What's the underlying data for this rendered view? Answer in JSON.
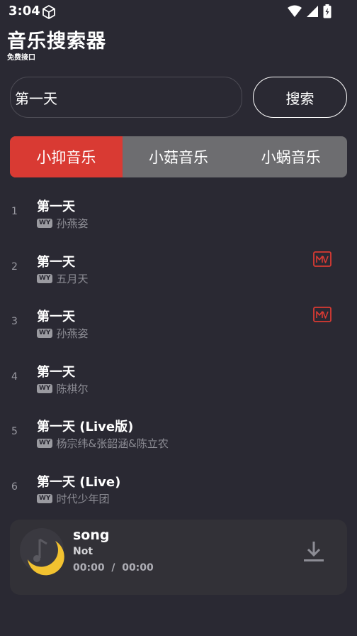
{
  "status": {
    "time": "3:04"
  },
  "app": {
    "title": "音乐搜索器",
    "subtitle": "免费接口"
  },
  "search": {
    "value": "第一天",
    "button_label": "搜索"
  },
  "tabs": [
    {
      "label": "小抑音乐",
      "active": true
    },
    {
      "label": "小菇音乐",
      "active": false
    },
    {
      "label": "小蜗音乐",
      "active": false
    }
  ],
  "songs": [
    {
      "index": "1",
      "title": "第一天",
      "badge": "WY",
      "artist": "孙燕姿",
      "has_mv": false
    },
    {
      "index": "2",
      "title": "第一天",
      "badge": "WY",
      "artist": "五月天",
      "has_mv": true
    },
    {
      "index": "3",
      "title": "第一天",
      "badge": "WY",
      "artist": "孙燕姿",
      "has_mv": true
    },
    {
      "index": "4",
      "title": "第一天",
      "badge": "WY",
      "artist": "陈棋尔",
      "has_mv": false
    },
    {
      "index": "5",
      "title": "第一天 (Live版)",
      "badge": "WY",
      "artist": "杨宗纬&张韶涵&陈立农",
      "has_mv": false
    },
    {
      "index": "6",
      "title": "第一天 (Live)",
      "badge": "WY",
      "artist": "时代少年团",
      "has_mv": false
    }
  ],
  "player": {
    "title": "song",
    "artist": "Not",
    "current_time": "00:00",
    "separator": "/",
    "total_time": "00:00"
  },
  "icons": {
    "mv": "mv-icon",
    "download": "download-icon",
    "disc": "music-disc-icon"
  },
  "colors": {
    "accent": "#d93a33",
    "background": "#2a2933",
    "player_bg": "#323137",
    "disc_moon": "#f2c230"
  }
}
